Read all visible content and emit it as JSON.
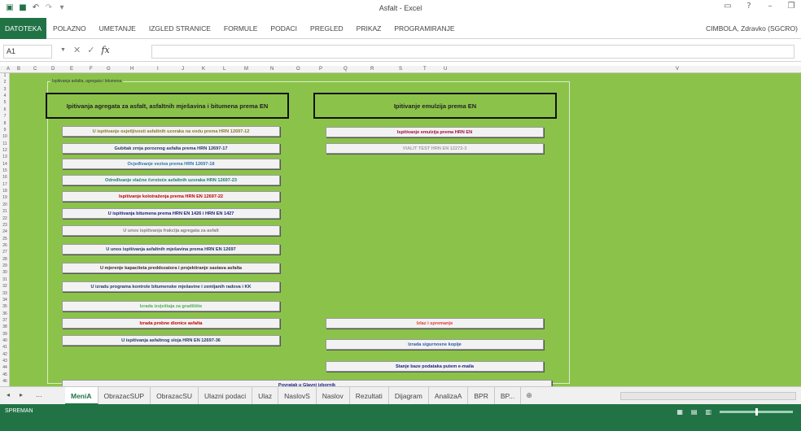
{
  "window": {
    "title": "Asfalt - Excel",
    "user": "CIMBOLA, Zdravko (SGCRO)"
  },
  "icons": {
    "app": "excel-icon",
    "save": "save-icon",
    "undo": "undo-icon",
    "redo": "redo-icon",
    "customize": "customize-qat-icon",
    "minimize": "minimize-icon",
    "restore": "restore-icon",
    "cancel": "cancel-icon",
    "confirm": "confirm-icon",
    "function": "function-icon"
  },
  "ribbon": {
    "tabs": [
      "DATOTEKA",
      "POLAZNO",
      "UMETANJE",
      "IZGLED STRANICE",
      "FORMULE",
      "PODACI",
      "PREGLED",
      "PRIKAZ",
      "PROGRAMIRANJE"
    ]
  },
  "formula": {
    "namebox": "A1",
    "fx": "fx",
    "value": ""
  },
  "columns": [
    "A",
    "B",
    "C",
    "D",
    "E",
    "F",
    "G",
    "H",
    "I",
    "J",
    "K",
    "L",
    "M",
    "N",
    "O",
    "P",
    "Q",
    "R",
    "S",
    "T",
    "U",
    "V"
  ],
  "rows": [
    "1",
    "2",
    "3",
    "4",
    "5",
    "6",
    "7",
    "8",
    "9",
    "10",
    "11",
    "12",
    "13",
    "14",
    "15",
    "16",
    "17",
    "18",
    "19",
    "20",
    "21",
    "22",
    "23",
    "24",
    "25",
    "26",
    "27",
    "28",
    "29",
    "30",
    "31",
    "32",
    "33",
    "34",
    "35",
    "36",
    "37",
    "38",
    "39",
    "40",
    "41",
    "42",
    "43",
    "44",
    "45",
    "46"
  ],
  "sheet": {
    "caption": "Ispitivanja asfalta, agregata i bitumena",
    "left_header": "Ipitivanja agregata za asfalt, asfaltnih mješavina i bitumena prema EN",
    "right_header": "Ipitivanje emulzija prema EN",
    "left_buttons": [
      "U ispitivanje osjetljivosti asfaltnih uzoraka na vodu prema HRN 12697-12",
      "Gubitak zrnja poroznog asfalta prema HRN 12697-17",
      "Ocjeđivanje veziva prema HRN 12697-18",
      "Određivanje vlačne čvrstoće asfaltnih uzoraka HRN 12697-23",
      "Ispitivanje kolotraženja prema HRN EN 12697-22",
      "U ispitivanja bitumena prema HRN EN 1426 i HRN EN 1427",
      "U unos ispitivanja frakcija agregata za asfalt",
      "U unos ispitivanja asfaltnih mješavina prema HRN EN 12697",
      "U mjerenje kapaciteta preddozatora i projektiranje sastava asfalta",
      "U izradu programa kontrole bitumenske mješavine i zemljanih radova i KK",
      "Izrada izvještaja za gradilište",
      "Izrada probne dionice asfalta",
      "U ispitivanja asfaltnog sloja HRN EN 12697-36"
    ],
    "left_button_colors": [
      "#8a7a2a",
      "#1f3864",
      "#2e75b6",
      "#1f7a7a",
      "#c00000",
      "#1a237e",
      "#7f7f7f",
      "#1f3864",
      "#3d2b1f",
      "#1f3864",
      "#4caf50",
      "#c00000",
      "#1f3864"
    ],
    "right_buttons": [
      "Ispitivanje emulzija prema HRN EN",
      "VIALIT TEST HRN EN 12272-3",
      "Izlaz i spremanje",
      "Izrada sigurnosne kopije",
      "Stanje baze podataka putem e-maila"
    ],
    "right_button_colors": [
      "#a0103a",
      "#9e9e9e",
      "#e53935",
      "#2e5aa8",
      "#1a237e"
    ],
    "bottom_button": "Povratak u Glavni izbornik",
    "bottom_button_color": "#1a237e"
  },
  "sheet_tabs": [
    "MeniA",
    "ObrazacSUP",
    "ObrazacSU",
    "Ulazni podaci",
    "Ulaz",
    "NaslovS",
    "Naslov",
    "Rezultati",
    "Dijagram",
    "AnalizaA",
    "BPR",
    "BP..."
  ],
  "sheet_nav": {
    "prev": "◂",
    "next": "▸",
    "more": "...",
    "add": "⊕"
  },
  "status": {
    "text": "SPREMAN",
    "view_icons": [
      "normal-view-icon",
      "page-layout-icon",
      "page-break-icon"
    ]
  }
}
